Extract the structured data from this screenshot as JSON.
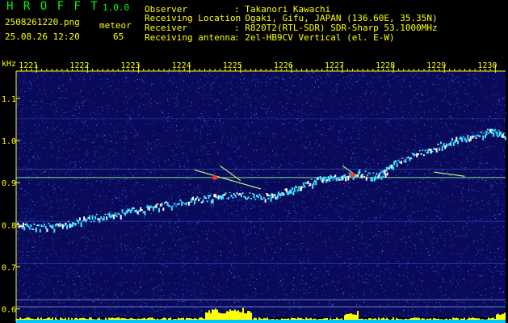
{
  "header": {
    "app_name": "H R O F F T",
    "version": "1.0.0",
    "filename": "2508261220.png",
    "datetime": "25.08.26 12:20",
    "meteor_label": "meteor",
    "meteor_count": "65",
    "fields": [
      {
        "label": "Observer",
        "value": ": Takanori Kawachi"
      },
      {
        "label": "Receiving Location",
        "value": ": Ogaki, Gifu, JAPAN (136.60E, 35.35N)"
      },
      {
        "label": "Receiver",
        "value": ": R820T2(RTL-SDR) SDR-Sharp 53.1000MHz"
      },
      {
        "label": "Receiving antenna",
        "value": ": 2el-HB9CV Vertical (el. E-W)"
      }
    ]
  },
  "chart_data": {
    "type": "heatmap",
    "ylabel": "kHz",
    "x_ticks": [
      "1221",
      "1222",
      "1223",
      "1224",
      "1225",
      "1226",
      "1227",
      "1228",
      "1229",
      "1230"
    ],
    "y_ticks": [
      "1.1",
      "1.0",
      "0.9",
      "0.8",
      "0.7",
      "0.6"
    ],
    "xlim": [
      1220.6,
      1230.2
    ],
    "ylim": [
      0.58,
      1.165
    ],
    "grid": true,
    "colors": {
      "background": "#0a0a5a",
      "noise": "#2a4fd0",
      "signal": "#40e0ff",
      "trace_hot": "#ff3030",
      "ticks": "#ffff00",
      "axis_text": "#ffff00",
      "bottom_level": "#ffff00"
    }
  }
}
